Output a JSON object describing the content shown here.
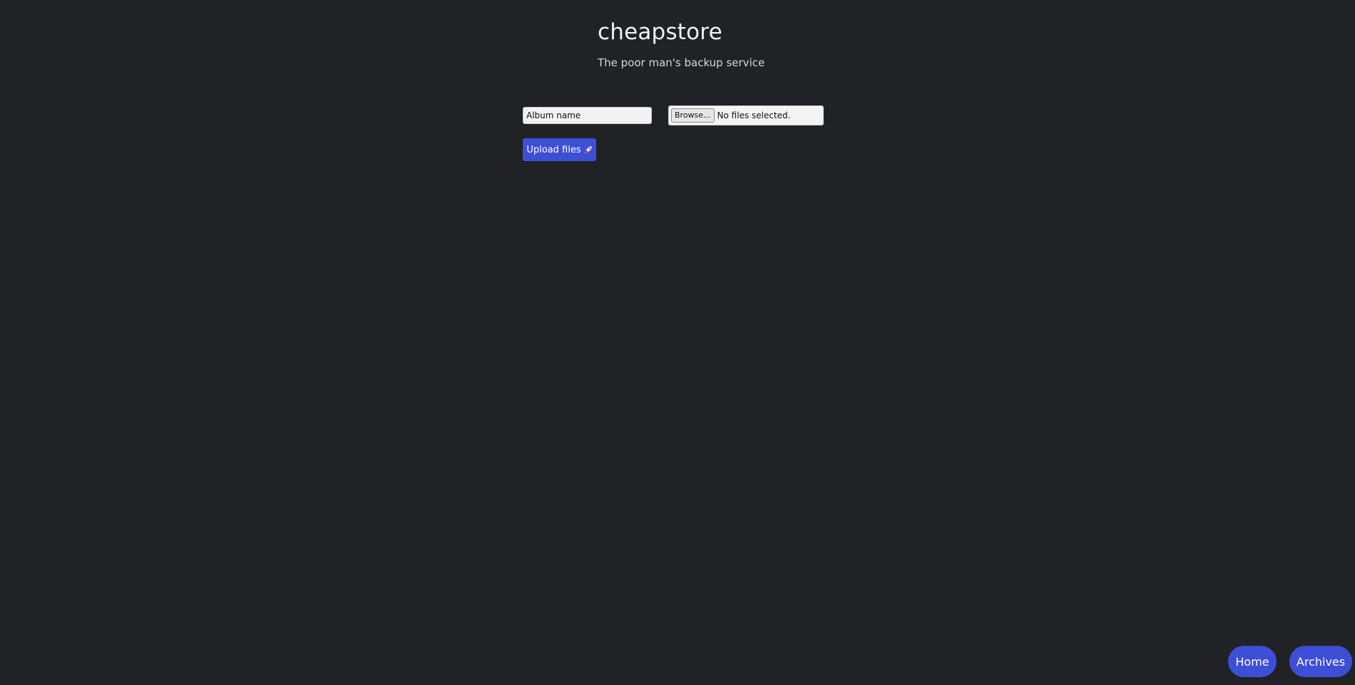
{
  "header": {
    "title": "cheapstore",
    "subtitle": "The poor man's backup service"
  },
  "form": {
    "album_placeholder": "Album name",
    "browse_label": "Browse...",
    "file_status": "No files selected.",
    "upload_label": "Upload files",
    "upload_icon": "rocket-icon"
  },
  "nav": {
    "home_label": "Home",
    "archives_label": "Archives"
  },
  "colors": {
    "background": "#212226",
    "accent": "#3d4fd6"
  }
}
